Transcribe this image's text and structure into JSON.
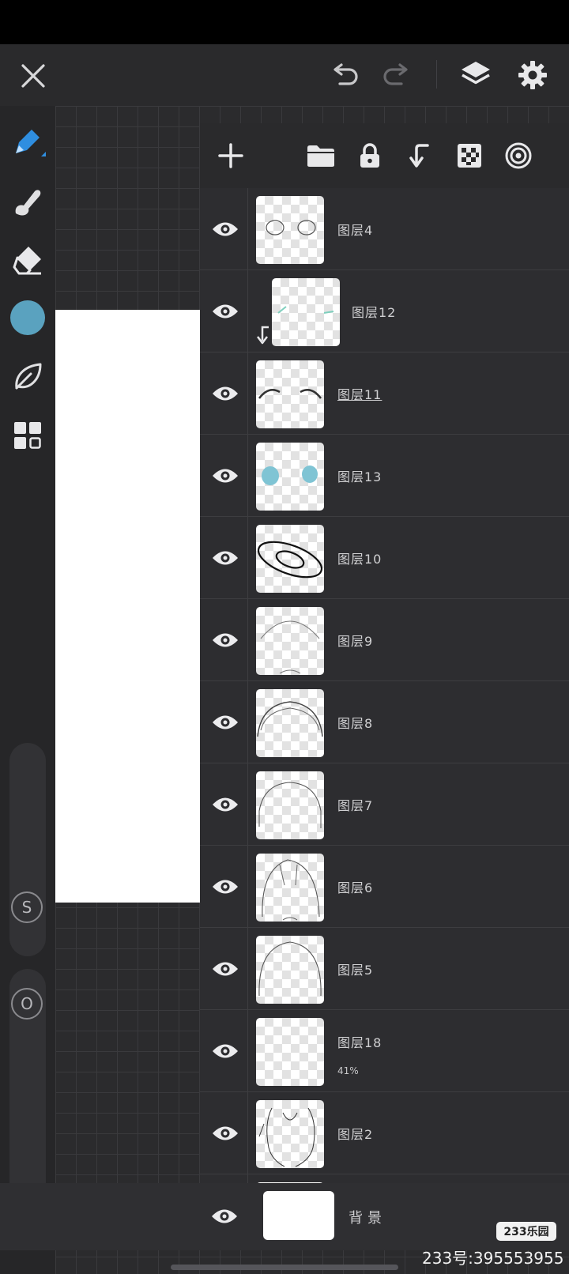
{
  "toolbar": {
    "close_icon": "close-icon",
    "undo_icon": "undo-icon",
    "redo_icon": "redo-icon",
    "layers_icon": "layers-icon",
    "settings_icon": "gear-icon"
  },
  "tools": {
    "items": [
      "pencil",
      "smudge",
      "eraser",
      "color",
      "leaf",
      "grid"
    ],
    "active": "pencil",
    "brush_color": "#5aa2bf",
    "size_knob_label": "S",
    "opacity_knob_label": "O"
  },
  "layers_panel": {
    "actions": [
      "add-layer",
      "folder",
      "lock",
      "clip",
      "alpha",
      "reference"
    ],
    "layers": [
      {
        "name": "图层4",
        "visible": true
      },
      {
        "name": "图层12",
        "visible": true,
        "clipped": true
      },
      {
        "name": "图层11",
        "visible": true,
        "selected": true
      },
      {
        "name": "图层13",
        "visible": true
      },
      {
        "name": "图层10",
        "visible": true
      },
      {
        "name": "图层9",
        "visible": true
      },
      {
        "name": "图层8",
        "visible": true
      },
      {
        "name": "图层7",
        "visible": true
      },
      {
        "name": "图层6",
        "visible": true
      },
      {
        "name": "图层5",
        "visible": true
      },
      {
        "name": "图层18",
        "visible": true,
        "opacity": "41%"
      },
      {
        "name": "图层2",
        "visible": true
      }
    ],
    "background": {
      "name": "背景",
      "visible": true
    }
  },
  "watermark": {
    "logo": "233乐园",
    "text": "233号:395553955"
  }
}
